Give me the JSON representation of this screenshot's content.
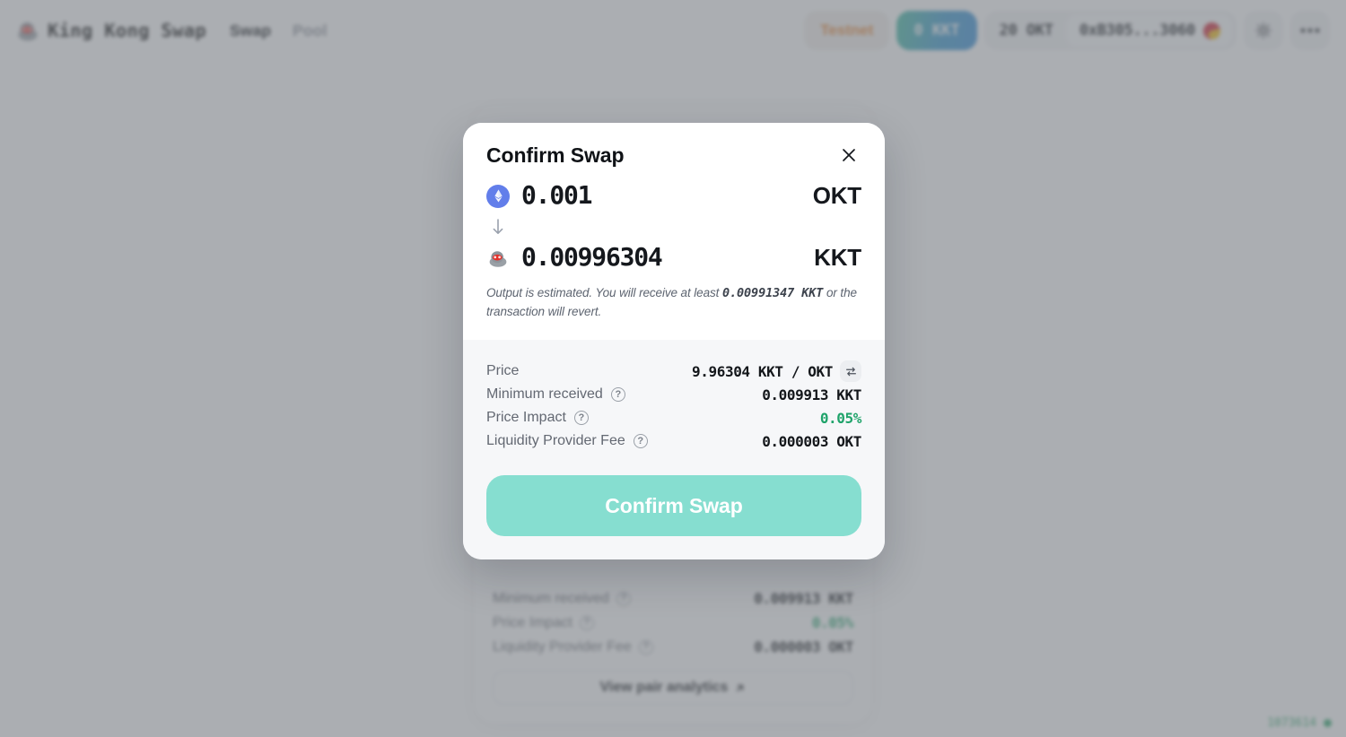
{
  "header": {
    "brand_name": "King Kong Swap",
    "brand_icon": "gorilla-logo-icon",
    "nav": [
      {
        "label": "Swap",
        "active": true
      },
      {
        "label": "Pool",
        "active": false
      }
    ],
    "network_badge": "Testnet",
    "token_balance": "0 KKT",
    "native_balance": "20 OKT",
    "account_address": "0xB305...3060",
    "wallet_icon": "wallet-pie-icon",
    "theme_icon": "sun-icon",
    "more_icon": "ellipsis-icon"
  },
  "background_card": {
    "rows": [
      {
        "label": "Minimum received",
        "help": "?",
        "value": "0.009913 KKT",
        "tone": "default"
      },
      {
        "label": "Price Impact",
        "help": "?",
        "value": "0.05%",
        "tone": "green"
      },
      {
        "label": "Liquidity Provider Fee",
        "help": "?",
        "value": "0.000003 OKT",
        "tone": "default"
      }
    ],
    "analytics_label": "View pair analytics",
    "analytics_icon": "external-link-arrow-icon"
  },
  "status": {
    "block_number": "1073614",
    "indicator": "online-dot"
  },
  "modal": {
    "title": "Confirm Swap",
    "close_icon": "close-icon",
    "from": {
      "amount": "0.001",
      "symbol": "OKT",
      "icon": "ethereum-token-icon"
    },
    "direction_icon": "arrow-down-icon",
    "to": {
      "amount": "0.00996304",
      "symbol": "KKT",
      "icon": "kingkong-token-icon"
    },
    "estimate_note_prefix": "Output is estimated. You will receive at least ",
    "estimate_note_strong": "0.00991347 KKT",
    "estimate_note_suffix": " or the transaction will revert.",
    "details": [
      {
        "label": "Price",
        "help": "",
        "value": "9.96304 KKT / OKT",
        "tone": "default",
        "action_icon": "swap-direction-icon"
      },
      {
        "label": "Minimum received",
        "help": "?",
        "value": "0.009913 KKT",
        "tone": "default",
        "action_icon": ""
      },
      {
        "label": "Price Impact",
        "help": "?",
        "value": "0.05%",
        "tone": "green",
        "action_icon": ""
      },
      {
        "label": "Liquidity Provider Fee",
        "help": "?",
        "value": "0.000003 OKT",
        "tone": "default",
        "action_icon": ""
      }
    ],
    "confirm_label": "Confirm Swap"
  },
  "colors": {
    "accent_confirm": "#86ded0",
    "brand_gradient_start": "#3bb89c",
    "brand_gradient_end": "#2f8ad6",
    "testnet_orange": "#e8802a",
    "positive_green": "#1fa36a",
    "eth_blue": "#627eea"
  }
}
